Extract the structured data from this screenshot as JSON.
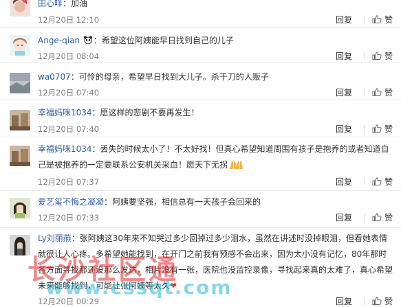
{
  "labels": {
    "reply": "回复",
    "like": "赞"
  },
  "comments": [
    {
      "user": "田心咩",
      "text": "：加油",
      "time": "12月20日 12:10"
    },
    {
      "user": "Ange-qian",
      "text": "：希望这位阿姨能早日找到自己的儿子",
      "time": "12月20日 08:04"
    },
    {
      "user": "wa0707",
      "text": "：可怜的母亲，希望早日找到大儿子。杀千刀的人贩子",
      "time": "12月20日 07:40"
    },
    {
      "user": "幸福妈咪1034",
      "text": "：愿这样的悲剧不要再发生！",
      "time": "12月20日 07:40"
    },
    {
      "user": "幸福妈咪1034",
      "text": "：丢失的时候太小了！不太好找！但真心希望知道周围有孩子是抱养的或者知道自己是被抱养的一定要联系公安机关采血！愿天下无拐",
      "time": "12月20日 07:37"
    },
    {
      "user": "爱艺玺不悔之凝凝",
      "text": "：阿姨要坚强，相信总有一天孩子会回来的",
      "time": "12月20日 07:33"
    },
    {
      "user": "Ly刘丽燕",
      "text": "：张阿姨这30年来不知哭过多少回掉过多少泪水，虽然在讲述时没掉眼泪，但看她表情就很让人心疼。多希望她能找到，在开门之前我有预感不会出来，因为太小没有记忆，80年那时各方面寻找都还没那么发达，相片没有一张，医院也没监控录像，寻找起来真的太难了，真心希望未来能够找到，可能让张阿姨等太久",
      "time": "12月20日 00:29"
    }
  ],
  "watermark": {
    "line1": "长沙社区通",
    "line2": "www.cssqt.com"
  }
}
